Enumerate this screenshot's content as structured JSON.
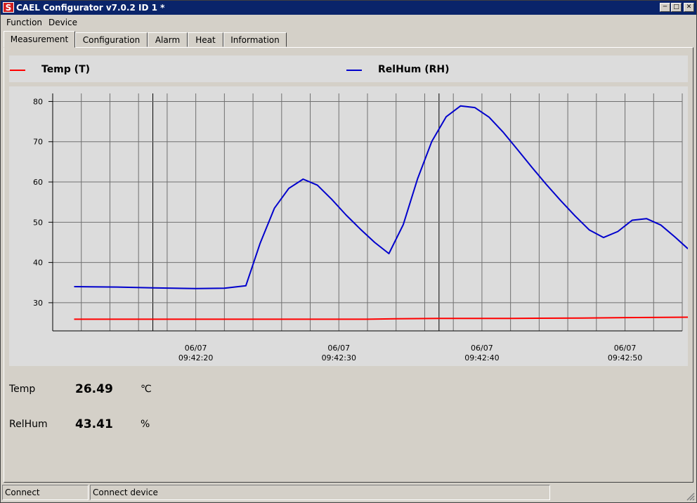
{
  "window": {
    "title": "CAEL Configurator v7.0.2 ID 1 *",
    "icon": "S"
  },
  "menu": [
    "Function",
    "Device"
  ],
  "tabs": [
    "Measurement",
    "Configuration",
    "Alarm",
    "Heat",
    "Information"
  ],
  "active_tab": "Measurement",
  "legend": [
    {
      "label": "Temp (T)",
      "color": "#ff0000"
    },
    {
      "label": "RelHum (RH)",
      "color": "#0000cc"
    }
  ],
  "readouts": [
    {
      "label": "Temp",
      "value": "26.49",
      "unit": "℃"
    },
    {
      "label": "RelHum",
      "value": "43.41",
      "unit": "%"
    }
  ],
  "status": [
    "Connect",
    "Connect device"
  ],
  "chart_data": {
    "type": "line",
    "ylim": [
      23,
      82
    ],
    "yticks": [
      30,
      40,
      50,
      60,
      70,
      80
    ],
    "xlim": [
      0,
      44
    ],
    "xtick_labels": [
      {
        "x": 10,
        "date": "06/07",
        "time": "09:42:20"
      },
      {
        "x": 20,
        "date": "06/07",
        "time": "09:42:30"
      },
      {
        "x": 30,
        "date": "06/07",
        "time": "09:42:40"
      },
      {
        "x": 40,
        "date": "06/07",
        "time": "09:42:50"
      }
    ],
    "major_grid_x": [
      7,
      27
    ],
    "grid": true,
    "series": [
      {
        "name": "Temp (T)",
        "color": "#ff0000",
        "x": [
          1.5,
          7,
          12,
          17,
          22,
          24,
          27,
          32,
          37,
          40,
          44.4
        ],
        "y": [
          25.9,
          25.9,
          25.9,
          25.9,
          25.9,
          26.0,
          26.1,
          26.1,
          26.2,
          26.3,
          26.4
        ]
      },
      {
        "name": "RelHum (RH)",
        "color": "#0000cc",
        "x": [
          1.5,
          4.5,
          7,
          10,
          12,
          13.5,
          14.5,
          15.5,
          16.5,
          17.5,
          18.5,
          19.5,
          20.5,
          21.5,
          22.5,
          23.5,
          24.5,
          25.5,
          26.5,
          27.5,
          28.5,
          29.5,
          30.5,
          31.5,
          32.5,
          33.5,
          34.5,
          35.5,
          36.5,
          37.5,
          38.5,
          39.5,
          40.5,
          41.5,
          42.5,
          43.5,
          44.4
        ],
        "y": [
          34.0,
          33.9,
          33.7,
          33.5,
          33.6,
          34.2,
          44.8,
          53.5,
          58.4,
          60.7,
          59.2,
          55.7,
          51.8,
          48.3,
          45.0,
          42.2,
          49.4,
          60.8,
          70.1,
          76.2,
          78.9,
          78.5,
          76.1,
          72.3,
          68.0,
          63.6,
          59.4,
          55.4,
          51.6,
          48.1,
          46.2,
          47.7,
          50.5,
          50.9,
          49.3,
          46.3,
          43.4
        ]
      }
    ]
  }
}
